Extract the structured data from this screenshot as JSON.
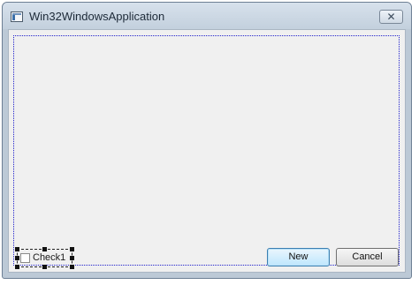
{
  "window": {
    "title": "Win32WindowsApplication",
    "close_symbol": "✕"
  },
  "checkbox": {
    "label": "Check1",
    "checked": false
  },
  "buttons": {
    "new_label": "New",
    "cancel_label": "Cancel"
  },
  "icons": {
    "app": "application-window-icon",
    "close": "close-icon"
  },
  "colors": {
    "title_bar": "#c3d0dd",
    "client_background": "#f0f0f0",
    "layout_guide": "#2222cc",
    "default_button_border": "#3c7fb1"
  }
}
